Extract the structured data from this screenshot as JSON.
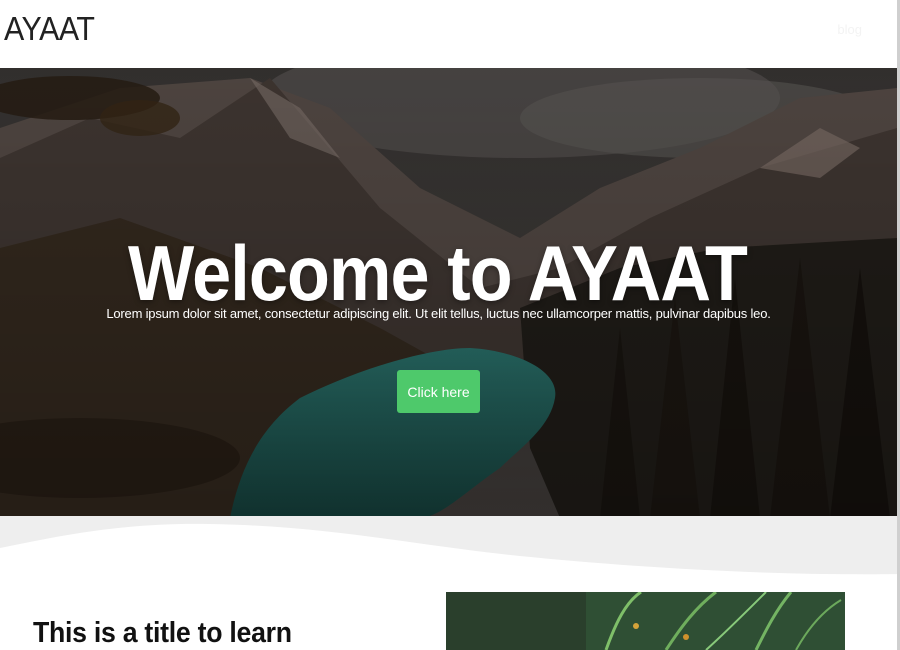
{
  "header": {
    "logo": "AYAAT",
    "nav_link": "blog"
  },
  "hero": {
    "title": "Welcome to AYAAT",
    "subtitle": "Lorem ipsum dolor sit amet, consectetur adipiscing elit. Ut elit tellus, luctus nec ullamcorper mattis, pulvinar dapibus leo.",
    "button_label": "Click here",
    "button_color": "#4ec96b"
  },
  "section": {
    "title": "This is a title to learn"
  },
  "colors": {
    "header_bg": "#ffffff",
    "wave": "#eeeeee",
    "text_dark": "#111111"
  }
}
